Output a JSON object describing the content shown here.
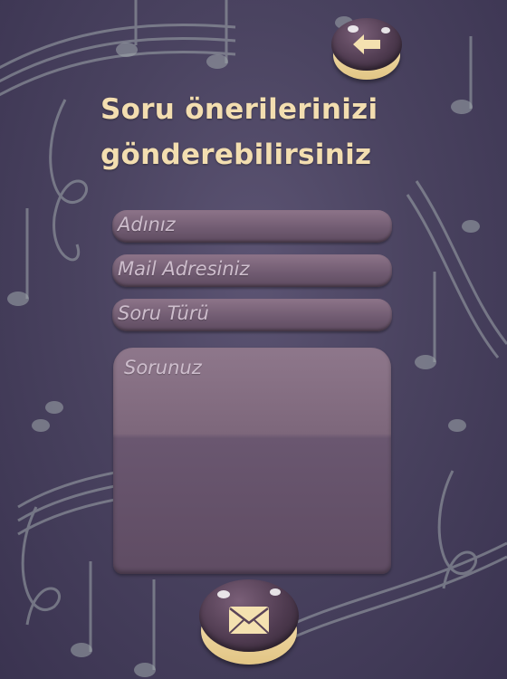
{
  "title": {
    "line1": "Soru önerilerinizi",
    "line2": "gönderebilirsiniz"
  },
  "form": {
    "name_placeholder": "Adınız",
    "email_placeholder": "Mail Adresiniz",
    "type_placeholder": "Soru Türü",
    "question_placeholder": "Sorunuz"
  },
  "icons": {
    "back": "arrow-left-icon",
    "send": "envelope-icon",
    "background": "music-notes-icon"
  },
  "colors": {
    "background": "#4a4360",
    "title": "#f3deb0",
    "field": "#7d667b",
    "button_base": "#f1dcaa",
    "button_top": "#5a4458"
  }
}
